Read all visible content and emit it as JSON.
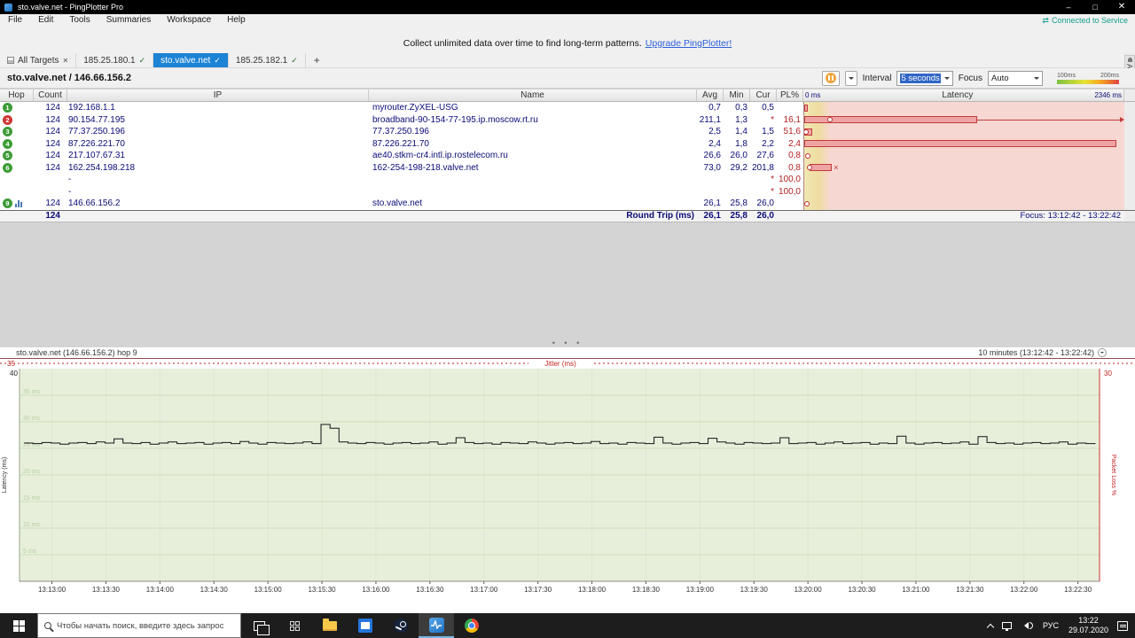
{
  "window": {
    "title": "sto.valve.net - PingPlotter Pro",
    "controls": {
      "minimize": "–",
      "maximize": "□",
      "close": "✕"
    }
  },
  "menubar": {
    "items": [
      "File",
      "Edit",
      "Tools",
      "Summaries",
      "Workspace",
      "Help"
    ],
    "connected_icon": "⇄",
    "connected": "Connected to Service"
  },
  "notice": {
    "text": "Collect unlimited data over time to find long-term patterns.",
    "link": "Upgrade PingPlotter!"
  },
  "tabbar": {
    "all_targets": "All Targets",
    "close_glyph": "✕",
    "check_glyph": "✓",
    "add_glyph": "+",
    "tabs": [
      {
        "label": "185.25.180.1"
      },
      {
        "label": "sto.valve.net"
      },
      {
        "label": "185.25.182.1"
      }
    ],
    "alerts": "Alerts"
  },
  "toolbar": {
    "target_title": "sto.valve.net / 146.66.156.2",
    "interval_label": "Interval",
    "interval_value": "5 seconds",
    "focus_label": "Focus",
    "focus_value": "Auto",
    "legend_100": "100ms",
    "legend_200": "200ms"
  },
  "table": {
    "headers": {
      "hop": "Hop",
      "count": "Count",
      "ip": "IP",
      "name": "Name",
      "avg": "Avg",
      "min": "Min",
      "cur": "Cur",
      "pl": "PL%",
      "latency": "Latency"
    },
    "scale_min": "0 ms",
    "scale_max": "2346 ms",
    "rows": [
      {
        "hop": "1",
        "hop_color": "#3c9b35",
        "count": "124",
        "ip": "192.168.1.1",
        "name": "myrouter.ZyXEL-USG",
        "avg": "0,7",
        "min": "0,3",
        "cur": "0,5",
        "pl": "",
        "lat": {
          "range": [
            0,
            1.2
          ]
        }
      },
      {
        "hop": "2",
        "hop_color": "#cf3434",
        "count": "124",
        "ip": "90.154.77.195",
        "name": "broadband-90-154-77-195.ip.moscow.rt.ru",
        "avg": "211,1",
        "min": "1,3",
        "cur": "*",
        "pl": "16,1",
        "lat": {
          "marker": 8,
          "range": [
            0,
            54
          ],
          "whisker": 98.5
        }
      },
      {
        "hop": "3",
        "hop_color": "#3c9b35",
        "count": "124",
        "ip": "77.37.250.196",
        "name": "77.37.250.196",
        "avg": "2,5",
        "min": "1,4",
        "cur": "1,5",
        "pl": "51,6",
        "lat": {
          "range": [
            0,
            2.4
          ],
          "marker": 0.6
        }
      },
      {
        "hop": "4",
        "hop_color": "#3c9b35",
        "count": "124",
        "ip": "87.226.221.70",
        "name": "87.226.221.70",
        "avg": "2,4",
        "min": "1,8",
        "cur": "2,2",
        "pl": "2,4",
        "lat": {
          "range": [
            0,
            97.5
          ]
        }
      },
      {
        "hop": "5",
        "hop_color": "#3c9b35",
        "count": "124",
        "ip": "217.107.67.31",
        "name": "ae40.stkm-cr4.intl.ip.rostelecom.ru",
        "avg": "26,6",
        "min": "26,0",
        "cur": "27,6",
        "pl": "0,8",
        "lat": {
          "marker": 1.2
        }
      },
      {
        "hop": "6",
        "hop_color": "#3c9b35",
        "count": "124",
        "ip": "162.254.198.218",
        "name": "162-254-198-218.valve.net",
        "avg": "73,0",
        "min": "29,2",
        "cur": "201,8",
        "pl": "0,8",
        "lat": {
          "marker": 1.6,
          "range": [
            1.6,
            8.5
          ],
          "x": 9.2
        }
      },
      {
        "hop": "",
        "hop_color": "",
        "count": "",
        "ip": "-",
        "name": "",
        "avg": "",
        "min": "",
        "cur": "*",
        "pl": "100,0",
        "lat": {}
      },
      {
        "hop": "",
        "hop_color": "",
        "count": "",
        "ip": "-",
        "name": "",
        "avg": "",
        "min": "",
        "cur": "*",
        "pl": "100,0",
        "lat": {}
      },
      {
        "hop": "9",
        "hop_color": "#3c9b35",
        "graph_icon": true,
        "count": "124",
        "ip": "146.66.156.2",
        "name": "sto.valve.net",
        "avg": "26,1",
        "min": "25,8",
        "cur": "26,0",
        "pl": "",
        "lat": {
          "marker": 0.8
        }
      }
    ],
    "roundtrip": {
      "count": "124",
      "label": "Round Trip (ms)",
      "avg": "26,1",
      "min": "25,8",
      "cur": "26,0"
    },
    "focus_text": "Focus: 13:12:42 - 13:22:42"
  },
  "chart_data": {
    "type": "line",
    "title": "sto.valve.net (146.66.156.2) hop 9",
    "time_span": "10 minutes (13:12:42 - 13:22:42)",
    "x_start": "13:12:42",
    "x_end": "13:22:42",
    "sample_interval_s": 5,
    "x_ticks": [
      "13:13:00",
      "13:13:30",
      "13:14:00",
      "13:14:30",
      "13:15:00",
      "13:15:30",
      "13:16:00",
      "13:16:30",
      "13:17:00",
      "13:17:30",
      "13:18:00",
      "13:18:30",
      "13:19:00",
      "13:19:30",
      "13:20:00",
      "13:20:30",
      "13:21:00",
      "13:21:30",
      "13:22:00",
      "13:22:30"
    ],
    "ylabel_left": "Latency (ms)",
    "ylabel_right": "Packet Loss %",
    "ylim_left": [
      0,
      40
    ],
    "ylim_right": [
      0,
      30
    ],
    "jitter_axis_max": 35,
    "jitter_label": "Jitter (ms)",
    "grid_labels": [
      "35 ms",
      "30 ms",
      "25 ms",
      "20 ms",
      "15 ms",
      "10 ms",
      "5 ms"
    ],
    "grid_step_ms": 5,
    "series": [
      {
        "name": "Latency (ms)",
        "values": [
          26.0,
          25.9,
          26.1,
          26.0,
          25.8,
          26.0,
          26.1,
          25.9,
          26.2,
          26.0,
          26.8,
          26.0,
          25.9,
          26.1,
          25.8,
          26.0,
          26.2,
          25.9,
          26.0,
          26.1,
          25.8,
          26.0,
          26.1,
          25.9,
          26.3,
          26.0,
          25.8,
          26.1,
          26.0,
          25.9,
          26.0,
          26.2,
          25.9,
          29.5,
          28.8,
          26.2,
          26.0,
          25.9,
          26.1,
          26.0,
          25.8,
          26.0,
          26.1,
          25.9,
          26.0,
          26.2,
          25.8,
          26.0,
          27.0,
          26.1,
          25.9,
          26.0,
          25.8,
          26.1,
          26.0,
          25.9,
          26.2,
          26.0,
          25.8,
          26.0,
          26.1,
          25.9,
          26.0,
          26.3,
          25.9,
          26.0,
          25.8,
          26.1,
          26.0,
          25.9,
          27.1,
          26.0,
          25.8,
          26.0,
          26.1,
          25.9,
          26.9,
          26.2,
          26.0,
          25.8,
          26.1,
          26.0,
          25.9,
          26.0,
          27.0,
          25.9,
          26.0,
          26.1,
          25.8,
          26.0,
          26.2,
          25.9,
          26.0,
          26.1,
          25.8,
          26.0,
          25.9,
          27.3,
          26.0,
          25.8,
          26.0,
          26.1,
          25.9,
          26.0,
          26.2,
          25.8,
          27.2,
          26.1,
          25.9,
          26.0,
          25.8,
          26.0,
          26.1,
          25.9,
          26.0,
          26.2,
          25.8,
          26.0,
          25.9,
          26.0
        ]
      }
    ],
    "colors": {
      "line": "#151515",
      "plot_bg": "#e7efdb",
      "grid": "#ccdcb8",
      "grid_text": "#b8cda2",
      "jitter": "#c32222",
      "axis_text": "#222"
    }
  },
  "taskbar": {
    "search_placeholder": "Чтобы начать поиск, введите здесь запрос",
    "tray": {
      "lang": "РУС",
      "time": "13:22",
      "date": "29.07.2020"
    }
  }
}
